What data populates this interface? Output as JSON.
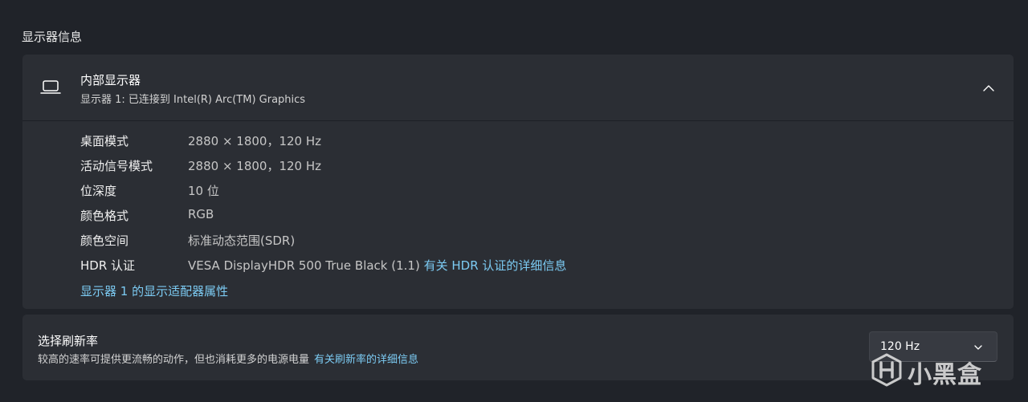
{
  "section_title": "显示器信息",
  "display": {
    "name": "内部显示器",
    "subtitle": "显示器 1: 已连接到 Intel(R) Arc(TM) Graphics",
    "icon": "laptop-icon",
    "expanded": true,
    "collapse_icon": "chevron-up-icon",
    "details": [
      {
        "label": "桌面模式",
        "value": "2880 × 1800，120 Hz"
      },
      {
        "label": "活动信号模式",
        "value": "2880 × 1800，120 Hz"
      },
      {
        "label": "位深度",
        "value": "10 位"
      },
      {
        "label": "颜色格式",
        "value": "RGB"
      },
      {
        "label": "颜色空间",
        "value": "标准动态范围(SDR)"
      },
      {
        "label": "HDR 认证",
        "value": "VESA DisplayHDR 500 True Black (1.1)",
        "link": "有关 HDR 认证的详细信息"
      }
    ],
    "adapter_link": "显示器 1 的显示适配器属性"
  },
  "refresh": {
    "title": "选择刷新率",
    "description": "较高的速率可提供更流畅的动作，但也消耗更多的电源电量",
    "link": "有关刷新率的详细信息",
    "selected": "120 Hz",
    "dropdown_icon": "chevron-down-icon"
  },
  "watermark": {
    "text": "小黑盒",
    "icon": "xiaoheihe-logo"
  },
  "colors": {
    "background": "#202329",
    "card": "#2b2e34",
    "link": "#7ccbf3",
    "dropdown": "#373a41"
  }
}
